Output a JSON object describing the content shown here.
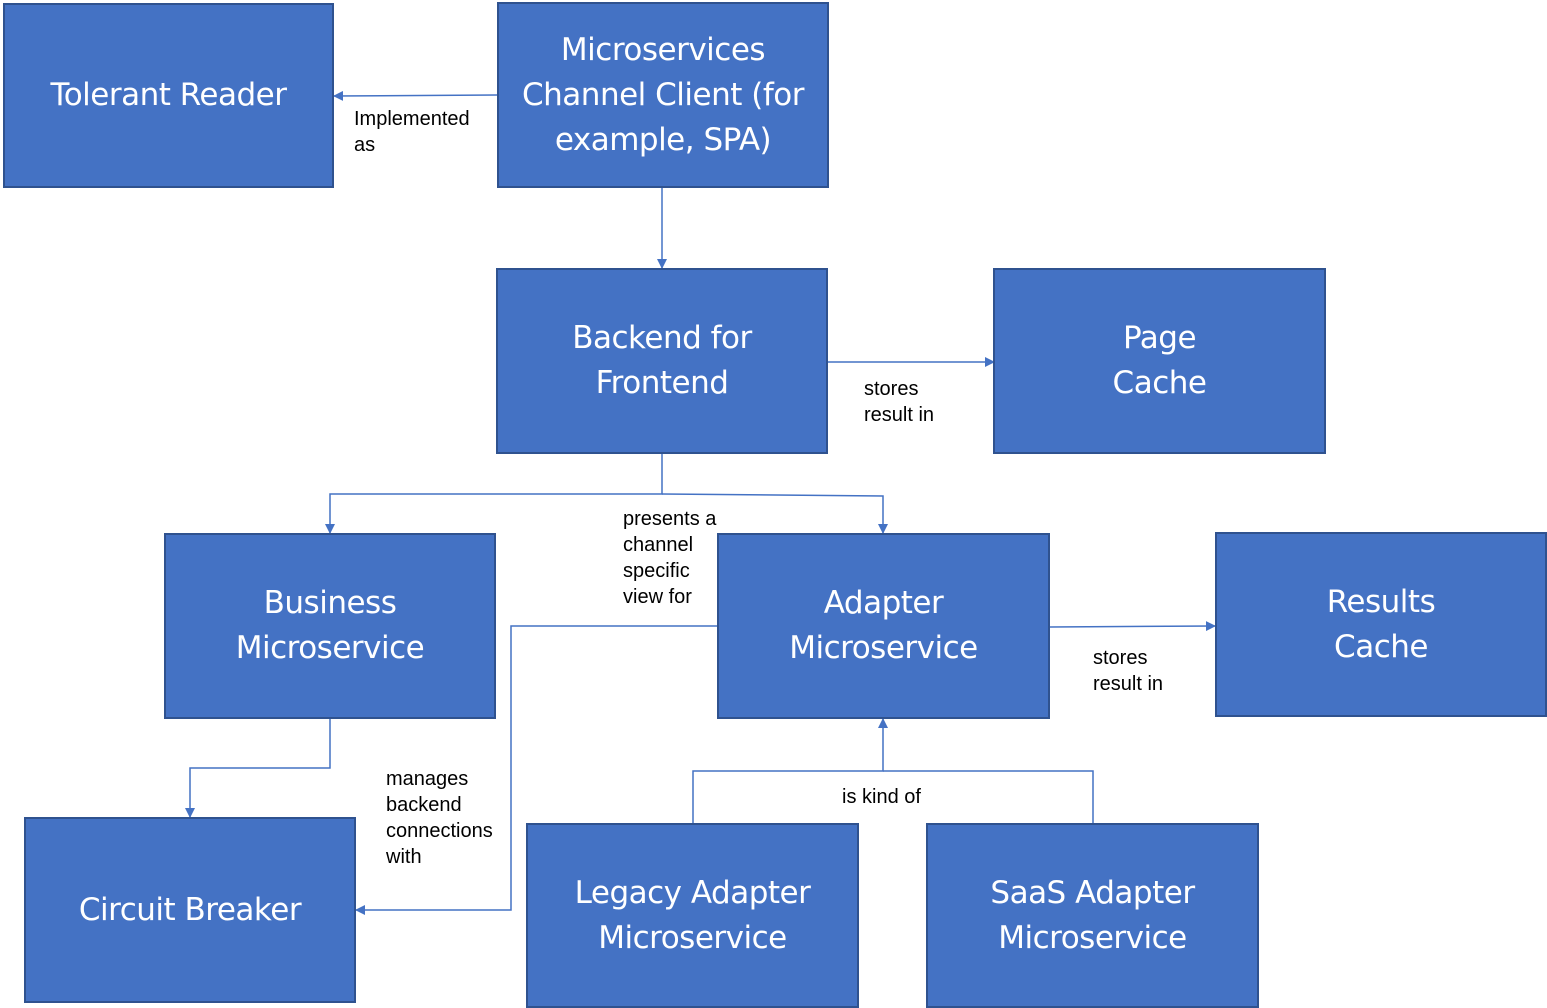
{
  "colors": {
    "box_fill": "#4472C4",
    "box_border": "#2F528F",
    "edge": "#4472C4",
    "label_text": "#000000",
    "box_text": "#FFFFFF"
  },
  "nodes": {
    "tolerant_reader": "Tolerant Reader",
    "channel_client": "Microservices\nChannel Client (for\nexample, SPA)",
    "bff": "Backend for\nFrontend",
    "page_cache": "Page\nCache",
    "business_ms": "Business\nMicroservice",
    "adapter_ms": "Adapter\nMicroservice",
    "results_cache": "Results\nCache",
    "circuit_breaker": "Circuit Breaker",
    "legacy_adapter": "Legacy Adapter\nMicroservice",
    "saas_adapter": "SaaS Adapter\nMicroservice"
  },
  "edges": [
    {
      "from": "channel_client",
      "to": "tolerant_reader",
      "label": "Implemented\nas"
    },
    {
      "from": "channel_client",
      "to": "bff",
      "label": ""
    },
    {
      "from": "bff",
      "to": "page_cache",
      "label": "stores\nresult in"
    },
    {
      "from": "bff",
      "to": "business_ms",
      "label": "presents a\nchannel\nspecific\nview for"
    },
    {
      "from": "bff",
      "to": "adapter_ms",
      "label": "presents a\nchannel\nspecific\nview for"
    },
    {
      "from": "adapter_ms",
      "to": "results_cache",
      "label": "stores\nresult in"
    },
    {
      "from": "business_ms",
      "to": "circuit_breaker",
      "label": "manages\nbackend\nconnections\nwith"
    },
    {
      "from": "adapter_ms",
      "to": "circuit_breaker",
      "label": "manages\nbackend\nconnections\nwith"
    },
    {
      "from": "legacy_adapter",
      "to": "adapter_ms",
      "label": "is kind of"
    },
    {
      "from": "saas_adapter",
      "to": "adapter_ms",
      "label": "is kind of"
    }
  ],
  "labels": {
    "implemented_as": "Implemented\nas",
    "stores_result_in_page": "stores\nresult in",
    "presents_view": "presents a\nchannel\nspecific\nview for",
    "stores_result_in_results": "stores\nresult in",
    "manages_connections": "manages\nbackend\nconnections\nwith",
    "is_kind_of": "is kind of"
  }
}
